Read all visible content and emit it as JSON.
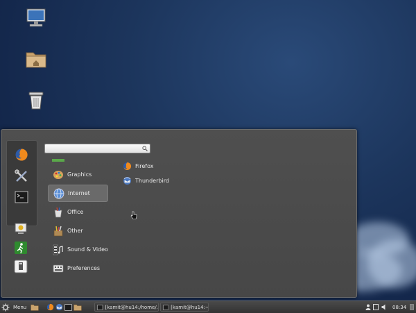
{
  "menu": {
    "search_value": "",
    "categories": [
      {
        "label": "Graphics",
        "icon": "graphics-icon"
      },
      {
        "label": "Internet",
        "icon": "internet-icon"
      },
      {
        "label": "Office",
        "icon": "office-icon"
      },
      {
        "label": "Other",
        "icon": "other-icon"
      },
      {
        "label": "Sound & Video",
        "icon": "sound-video-icon"
      },
      {
        "label": "Preferences",
        "icon": "preferences-icon"
      }
    ],
    "selected_category": "Internet",
    "apps": [
      {
        "label": "Firefox",
        "icon": "firefox-icon"
      },
      {
        "label": "Thunderbird",
        "icon": "thunderbird-icon"
      }
    ],
    "favorites": [
      "firefox-icon",
      "settings-tools-icon",
      "terminal-icon"
    ],
    "system": [
      "lock-screen-icon",
      "logout-icon",
      "shutdown-icon"
    ]
  },
  "taskbar": {
    "menu_label": "Menu",
    "windows": [
      {
        "label": "[kamit@hu14:/home/..."
      },
      {
        "label": "[kamit@hu14:~]"
      }
    ],
    "clock": "08:34"
  },
  "colors": {
    "menu_bg": "#4b4b4b",
    "selected_bg": "#6a6a6a",
    "desktop_bg": "#1c355c"
  }
}
